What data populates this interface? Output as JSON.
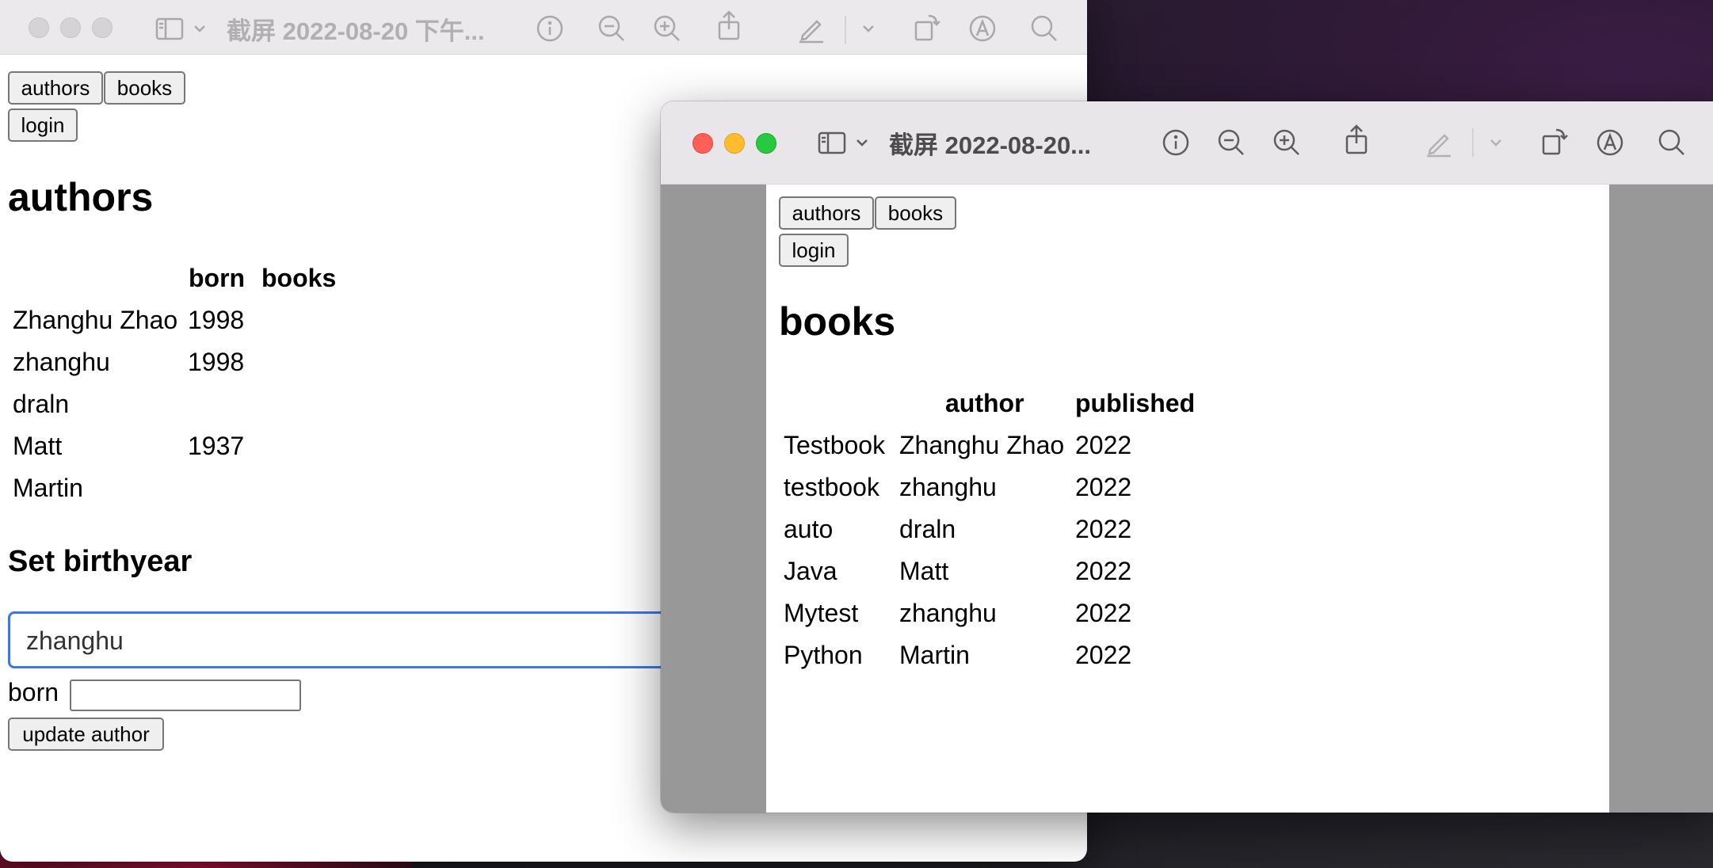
{
  "back_window": {
    "title": "截屏 2022-08-20 下午...",
    "nav": {
      "authors": "authors",
      "books": "books",
      "login": "login"
    },
    "heading": "authors",
    "table": {
      "headers": [
        "",
        "born",
        "books"
      ],
      "rows": [
        [
          "Zhanghu Zhao",
          "1998",
          ""
        ],
        [
          "zhanghu",
          "1998",
          ""
        ],
        [
          "draln",
          "",
          ""
        ],
        [
          "Matt",
          "1937",
          ""
        ],
        [
          "Martin",
          "",
          ""
        ]
      ]
    },
    "form": {
      "heading": "Set birthyear",
      "select_value": "zhanghu",
      "born_label": "born",
      "born_value": "",
      "submit": "update author"
    }
  },
  "front_window": {
    "title": "截屏 2022-08-20...",
    "nav": {
      "authors": "authors",
      "books": "books",
      "login": "login"
    },
    "heading": "books",
    "table": {
      "headers": [
        "",
        "author",
        "published"
      ],
      "rows": [
        [
          "Testbook",
          "Zhanghu Zhao",
          "2022"
        ],
        [
          "testbook",
          "zhanghu",
          "2022"
        ],
        [
          "auto",
          "draln",
          "2022"
        ],
        [
          "Java",
          "Matt",
          "2022"
        ],
        [
          "Mytest",
          "zhanghu",
          "2022"
        ],
        [
          "Python",
          "Martin",
          "2022"
        ]
      ]
    }
  },
  "colors": {
    "focus_ring": "#3b78e7",
    "traffic_red": "#fe5f57",
    "traffic_yellow": "#febc2e",
    "traffic_green": "#28c840"
  }
}
